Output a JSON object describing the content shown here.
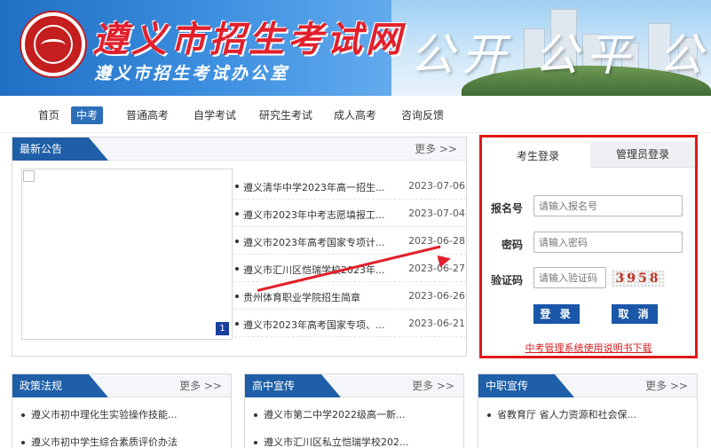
{
  "header": {
    "site_title": "遵义市招生考试网",
    "site_subtitle": "遵义市招生考试办公室",
    "slogan": "公开 公平 公正",
    "brand_color": "#e2202c"
  },
  "nav": {
    "items": [
      {
        "label": "首页"
      },
      {
        "label": "中考"
      },
      {
        "label": "普通高考"
      },
      {
        "label": "自学考试"
      },
      {
        "label": "研究生考试"
      },
      {
        "label": "成人高考"
      },
      {
        "label": "咨询反馈"
      }
    ],
    "active": "中考"
  },
  "notices": {
    "title": "最新公告",
    "more": "更多 >>",
    "page_indicator": "1",
    "items": [
      {
        "title": "遵义清华中学2023年高一招生...",
        "date": "2023-07-06"
      },
      {
        "title": "遵义市2023年中考志愿填报工...",
        "date": "2023-07-04"
      },
      {
        "title": "遵义市2023年高考国家专项计...",
        "date": "2023-06-28"
      },
      {
        "title": "遵义市汇川区恺瑞学校2023年...",
        "date": "2023-06-27"
      },
      {
        "title": "贵州体育职业学院招生简章",
        "date": "2023-06-26"
      },
      {
        "title": "遵义市2023年高考国家专项、...",
        "date": "2023-06-21"
      }
    ]
  },
  "login": {
    "tabs": [
      {
        "label": "考生登录"
      },
      {
        "label": "管理员登录"
      }
    ],
    "fields": {
      "reg_no": {
        "label": "报名号",
        "placeholder": "请输入报名号"
      },
      "password": {
        "label": "密码",
        "placeholder": "请输入密码"
      },
      "captcha": {
        "label": "验证码",
        "placeholder": "请输入验证码"
      }
    },
    "captcha_code": "3958",
    "login_button": "登 录",
    "cancel_button": "取 消",
    "manual_link": "中考管理系统使用说明书下载"
  },
  "policy": {
    "title": "政策法规",
    "more": "更多 >>",
    "items": [
      "遵义市初中理化生实验操作技能...",
      "遵义市初中学生综合素质评价办法"
    ]
  },
  "highschool": {
    "title": "高中宣传",
    "more": "更多 >>",
    "items": [
      "遵义市第二中学2022级高一新...",
      "遵义市汇川区私立恺瑞学校202..."
    ]
  },
  "vocational": {
    "title": "中职宣传",
    "more": "更多 >>",
    "items": [
      "省教育厅 省人力资源和社会保..."
    ]
  }
}
